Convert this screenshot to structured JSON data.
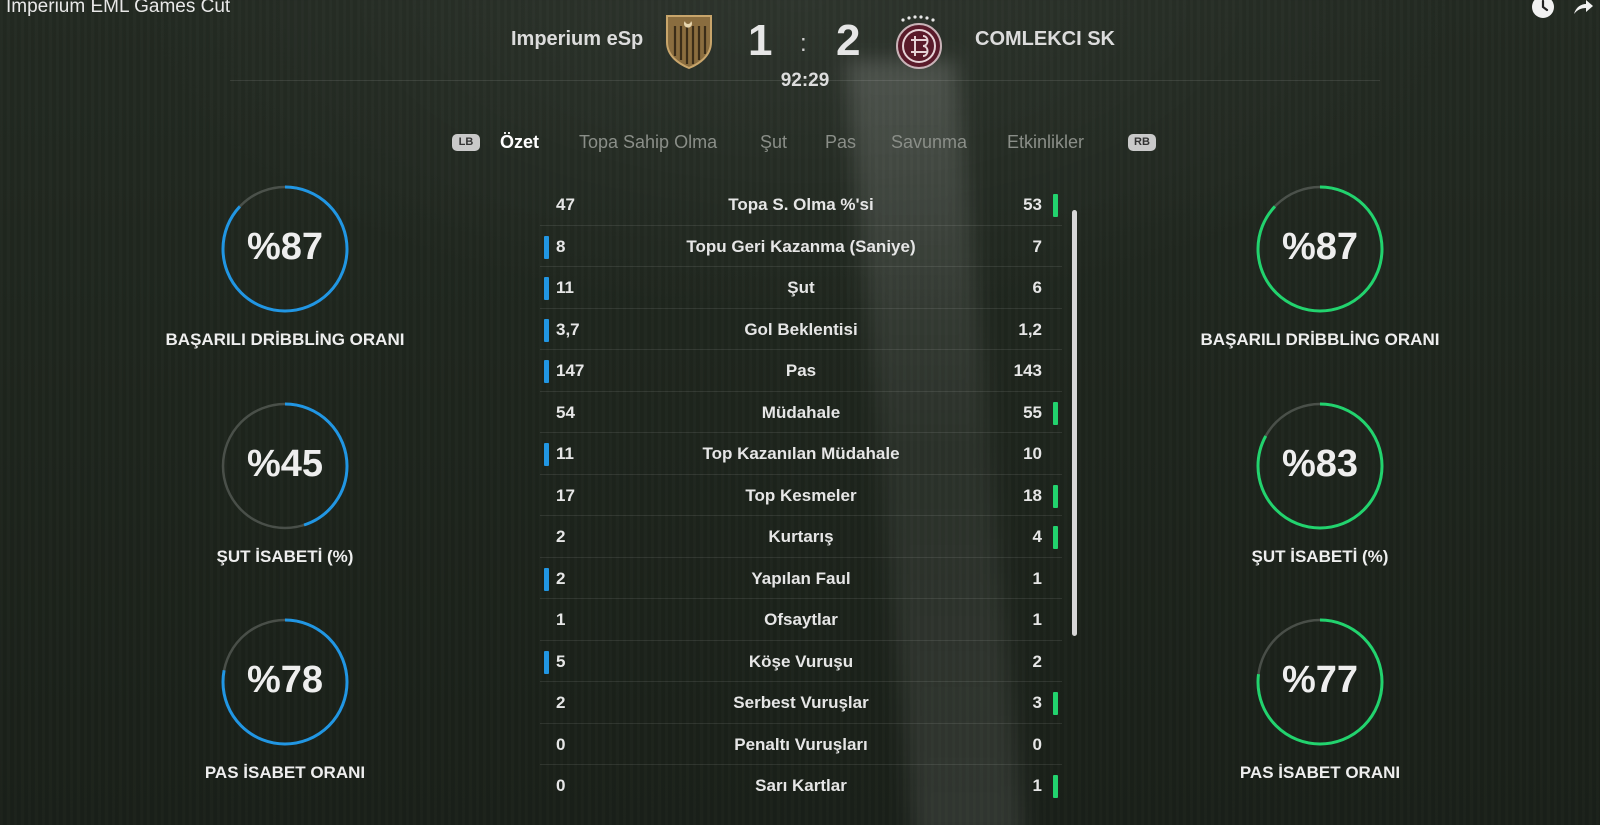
{
  "video": {
    "title": "Imperium EML Games Cut",
    "icons": [
      "clock-icon",
      "share-icon"
    ]
  },
  "match": {
    "home_team": "Imperium eSp",
    "away_team": "COMLEKCI SK",
    "home_score": "1",
    "separator": ":",
    "away_score": "2",
    "time": "92:29",
    "home_color": "#2196e3",
    "away_color": "#22d36e"
  },
  "tabs": {
    "lb": "LB",
    "rb": "RB",
    "items": [
      "Özet",
      "Topa Sahip Olma",
      "Şut",
      "Pas",
      "Savunma",
      "Etkinlikler"
    ],
    "active": "Özet"
  },
  "stats": [
    {
      "label": "Topa S. Olma %'si",
      "home": "47",
      "away": "53",
      "leader": "away"
    },
    {
      "label": "Topu Geri Kazanma (Saniye)",
      "home": "8",
      "away": "7",
      "leader": "home"
    },
    {
      "label": "Şut",
      "home": "11",
      "away": "6",
      "leader": "home"
    },
    {
      "label": "Gol Beklentisi",
      "home": "3,7",
      "away": "1,2",
      "leader": "home"
    },
    {
      "label": "Pas",
      "home": "147",
      "away": "143",
      "leader": "home"
    },
    {
      "label": "Müdahale",
      "home": "54",
      "away": "55",
      "leader": "away"
    },
    {
      "label": "Top Kazanılan Müdahale",
      "home": "11",
      "away": "10",
      "leader": "home"
    },
    {
      "label": "Top Kesmeler",
      "home": "17",
      "away": "18",
      "leader": "away"
    },
    {
      "label": "Kurtarış",
      "home": "2",
      "away": "4",
      "leader": "away"
    },
    {
      "label": "Yapılan Faul",
      "home": "2",
      "away": "1",
      "leader": "home"
    },
    {
      "label": "Ofsaytlar",
      "home": "1",
      "away": "1",
      "leader": "none"
    },
    {
      "label": "Köşe Vuruşu",
      "home": "5",
      "away": "2",
      "leader": "home"
    },
    {
      "label": "Serbest Vuruşlar",
      "home": "2",
      "away": "3",
      "leader": "away"
    },
    {
      "label": "Penaltı Vuruşları",
      "home": "0",
      "away": "0",
      "leader": "none"
    },
    {
      "label": "Sarı Kartlar",
      "home": "0",
      "away": "1",
      "leader": "away"
    }
  ],
  "rings": {
    "home": [
      {
        "text": "%87",
        "caption": "BAŞARILI DRİBBLİNG ORANI",
        "fraction": 0.87
      },
      {
        "text": "%45",
        "caption": "ŞUT İSABETİ (%)",
        "fraction": 0.45
      },
      {
        "text": "%78",
        "caption": "PAS İSABET ORANI",
        "fraction": 0.78
      }
    ],
    "away": [
      {
        "text": "%87",
        "caption": "BAŞARILI DRİBBLİNG ORANI",
        "fraction": 0.87
      },
      {
        "text": "%83",
        "caption": "ŞUT İSABETİ (%)",
        "fraction": 0.83
      },
      {
        "text": "%77",
        "caption": "PAS İSABET ORANI",
        "fraction": 0.77
      }
    ]
  }
}
